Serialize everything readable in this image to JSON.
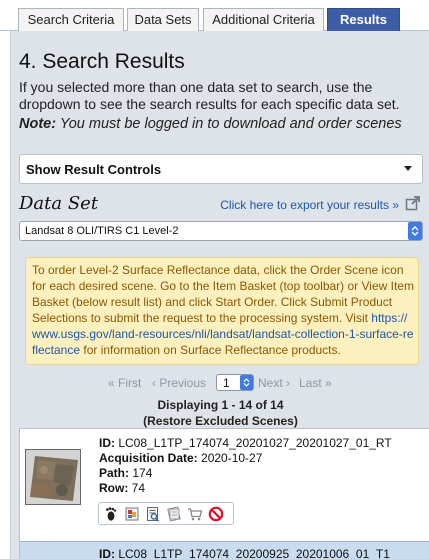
{
  "tabs": [
    {
      "label": "Search Criteria",
      "active": false
    },
    {
      "label": "Data Sets",
      "active": false
    },
    {
      "label": "Additional Criteria",
      "active": false
    },
    {
      "label": "Results",
      "active": true
    }
  ],
  "section_title": "4. Search Results",
  "intro_text": "If you selected more than one data set to search, use the dropdown to see the search results for each specific data set.",
  "note_label": "Note:",
  "note_text": "You must be logged in to download and order scenes",
  "result_controls_label": "Show Result Controls",
  "data_set_label": "Data Set",
  "export_link": "Click here to export your results »",
  "data_set_selected": "Landsat 8 OLI/TIRS C1 Level-2",
  "alert": {
    "text_before": "To order Level-2 Surface Reflectance data, click the Order Scene icon for each desired scene. Go to the Item Basket (top toolbar) or View Item Basket (below result list) and click Start Order. Click Submit Product Selections to submit the request to the processing system. Visit ",
    "link": "https://www.usgs.gov/land-resources/nli/landsat/landsat-collection-1-surface-reflectance",
    "text_after": " for information on Surface Reflectance products."
  },
  "pager": {
    "first": "« First",
    "previous": "‹ Previous",
    "page": "1",
    "next": "Next ›",
    "last": "Last »"
  },
  "displaying": "Displaying 1 - 14 of 14",
  "restore": "(Restore Excluded Scenes)",
  "results": [
    {
      "id_label": "ID:",
      "id": "LC08_L1TP_174074_20201027_20201027_01_RT",
      "date_label": "Acquisition Date:",
      "date": "2020-10-27",
      "path_label": "Path:",
      "path": "174",
      "row_label": "Row:",
      "row": "74"
    },
    {
      "id_label": "ID:",
      "id": "LC08_L1TP_174074_20200925_20201006_01_T1"
    }
  ],
  "tool_icons": [
    "footprint-icon",
    "overlay-icon",
    "metadata-icon",
    "compare-icon",
    "order-cart-icon",
    "exclude-icon"
  ],
  "colors": {
    "active_tab": "#3d5da6",
    "panel_bg": "#dde3e9",
    "alert_bg": "#fdf0bf",
    "alert_text": "#8a5800",
    "link": "#1d57a8",
    "selected_row": "#c9dbef"
  }
}
